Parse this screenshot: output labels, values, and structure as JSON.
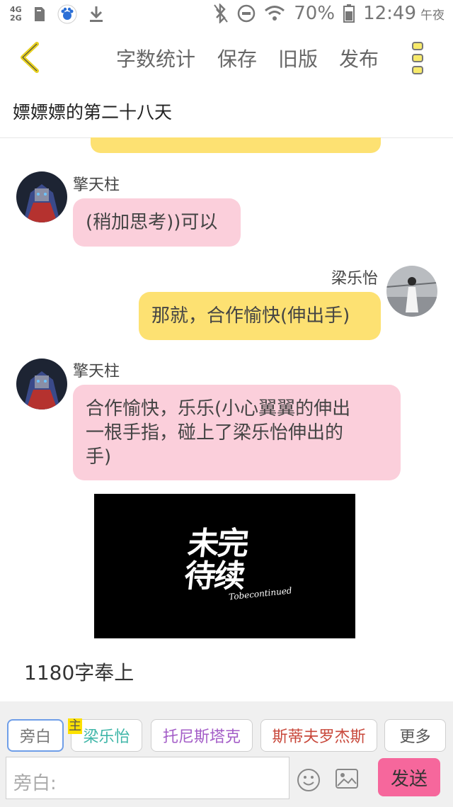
{
  "status_bar": {
    "network_top": "4G",
    "network_bottom": "2G",
    "battery": "70%",
    "time": "12:49",
    "period": "午夜"
  },
  "header": {
    "actions": [
      "字数统计",
      "保存",
      "旧版",
      "发布"
    ]
  },
  "story": {
    "title": "嫖嫖嫖的第二十八天"
  },
  "messages": [
    {
      "name": "擎天柱",
      "text": "(稍加思考))可以"
    },
    {
      "name": "梁乐怡",
      "text": "那就，合作愉快(伸出手)"
    },
    {
      "name": "擎天柱",
      "lines": [
        "合作愉快，乐乐(小心翼翼的伸出",
        "一根手指，碰上了梁乐怡伸出的",
        "手)"
      ]
    }
  ],
  "image_card": {
    "title_line1": "未完",
    "title_line2": "待续",
    "subtitle": "Tobecontinued"
  },
  "word_note": "1180字奉上",
  "roles": {
    "narration": "旁白",
    "lead_tag": "主",
    "lead": "梁乐怡",
    "role2": "托尼斯塔克",
    "role3": "斯蒂夫罗杰斯",
    "more": "更多"
  },
  "input": {
    "placeholder": "旁白:"
  },
  "send_label": "发送",
  "colors": {
    "yellow_bubble": "#fde172",
    "pink_bubble": "#fbcfdb",
    "send_button": "#f6679c",
    "teal_role": "#3fb6a8",
    "purple_role": "#a35cc7",
    "red_role": "#c8473a",
    "back_arrow": "#e6cf1e"
  }
}
